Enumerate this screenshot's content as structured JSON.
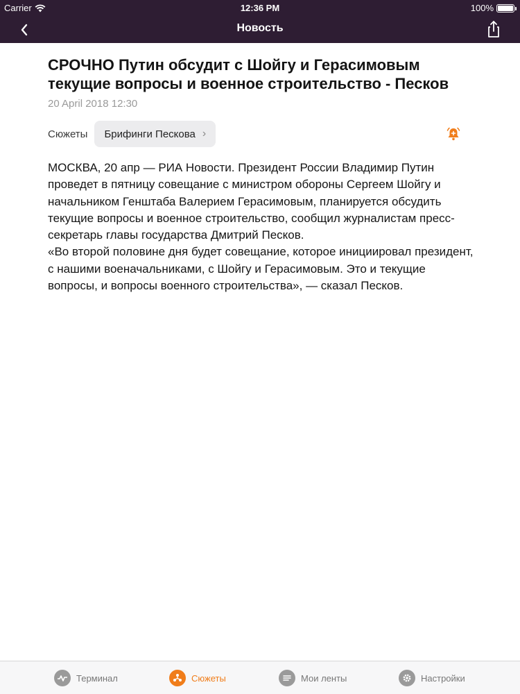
{
  "status_bar": {
    "carrier": "Carrier",
    "time": "12:36 PM",
    "battery": "100%",
    "battery_level": 1.0
  },
  "nav": {
    "title": "Новость",
    "back_icon": "chevron-left-icon",
    "share_icon": "share-icon"
  },
  "article": {
    "headline": "СРОЧНО Путин обсудит с Шойгу и Герасимовым текущие вопросы и военное строительство - Песков",
    "date": "20 April 2018 12:30",
    "topics_label": "Сюжеты",
    "topic_chip": "Брифинги Пескова",
    "bell_icon": "bell-plus-icon",
    "paragraphs": [
      "МОСКВА, 20 апр — РИА Новости. Президент России Владимир Путин проведет в пятницу совещание с министром обороны Сергеем Шойгу и начальником Генштаба Валерием Герасимовым, планируется обсудить текущие вопросы и военное строительство, сообщил журналистам пресс-секретарь главы государства Дмитрий Песков.",
      "«Во второй половине дня будет совещание, которое инициировал президент, с нашими военачальниками, с Шойгу и Герасимовым. Это и текущие вопросы, и вопросы военного строительства», — сказал Песков."
    ]
  },
  "tabbar": {
    "tabs": [
      {
        "label": "Терминал",
        "icon": "pulse-icon",
        "active": false
      },
      {
        "label": "Сюжеты",
        "icon": "stories-icon",
        "active": true
      },
      {
        "label": "Мои ленты",
        "icon": "list-icon",
        "active": false
      },
      {
        "label": "Настройки",
        "icon": "gear-icon",
        "active": false
      }
    ]
  },
  "colors": {
    "nav_background": "#2e1d33",
    "accent": "#f07d1a",
    "chip_background": "#ececee"
  }
}
